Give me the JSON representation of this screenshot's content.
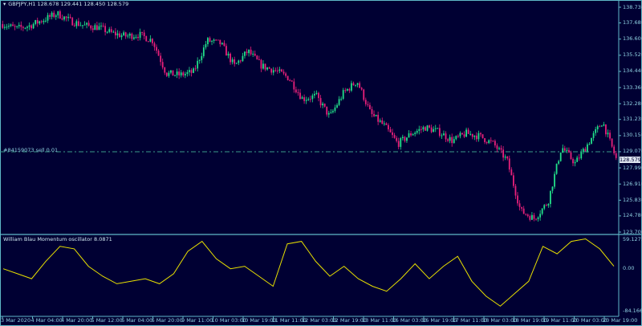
{
  "window": {
    "symbol_line": "GBPJPY,H1  128.678 129.441 128.450 128.579"
  },
  "order_line": {
    "label": "#84159073 sell 0.01",
    "price": 129.07
  },
  "current_price": {
    "label": "128.579",
    "value": 128.579
  },
  "oscillator": {
    "title": "William Blau Momentum oscillator 8.0871",
    "scale_labels": [
      "59.1275",
      "0.00",
      "-84.1665"
    ]
  },
  "price_axis": {
    "labels": [
      "138.730",
      "137.680",
      "136.600",
      "135.520",
      "134.440",
      "133.360",
      "132.280",
      "131.230",
      "130.150",
      "129.070",
      "127.990",
      "126.910",
      "125.830",
      "124.780",
      "123.700"
    ]
  },
  "time_axis": {
    "labels": [
      "3 Mar 2020",
      "4 Mar 04:00",
      "4 Mar 20:00",
      "5 Mar 12:00",
      "6 Mar 04:00",
      "6 Mar 20:00",
      "9 Mar 11:00",
      "10 Mar 03:00",
      "10 Mar 19:00",
      "11 Mar 11:00",
      "12 Mar 03:00",
      "12 Mar 19:00",
      "13 Mar 11:00",
      "16 Mar 03:00",
      "16 Mar 19:00",
      "17 Mar 11:00",
      "18 Mar 03:00",
      "18 Mar 19:00",
      "19 Mar 11:00",
      "20 Mar 03:00",
      "20 Mar 19:00"
    ]
  },
  "colors": {
    "background": "#000033",
    "bull": "#22e08a",
    "bear": "#e8207a",
    "osc_line": "#e8e000",
    "axis_text": "#8fd0e0",
    "grid_border": "#5fb8c8",
    "order_line": "#3a9a8a"
  },
  "chart_data": {
    "type": "candlestick",
    "symbol": "GBPJPY",
    "timeframe": "H1",
    "price_range": [
      123.7,
      138.73
    ],
    "close_path_approx": [
      137.6,
      137.3,
      137.5,
      137.9,
      138.3,
      137.8,
      137.5,
      137.4,
      137.0,
      136.8,
      136.9,
      136.5,
      134.3,
      134.2,
      134.4,
      136.5,
      136.3,
      134.8,
      135.8,
      134.8,
      134.5,
      134.0,
      132.6,
      132.8,
      131.4,
      133.0,
      133.8,
      131.6,
      130.8,
      129.6,
      130.3,
      130.7,
      130.4,
      129.8,
      130.3,
      130.1,
      129.6,
      128.5,
      125.1,
      124.6,
      125.7,
      129.4,
      128.3,
      129.7,
      131.1,
      128.6
    ],
    "oscillator_range": [
      -84.1665,
      59.1275
    ],
    "oscillator_values": [
      0,
      -10,
      -20,
      15,
      45,
      40,
      5,
      -15,
      -30,
      -25,
      -20,
      -30,
      -10,
      35,
      55,
      20,
      0,
      5,
      -15,
      -35,
      50,
      55,
      15,
      -15,
      5,
      -20,
      -35,
      -45,
      -20,
      10,
      -20,
      5,
      25,
      -25,
      -55,
      -75,
      -50,
      -25,
      45,
      30,
      55,
      60,
      40,
      5
    ]
  }
}
